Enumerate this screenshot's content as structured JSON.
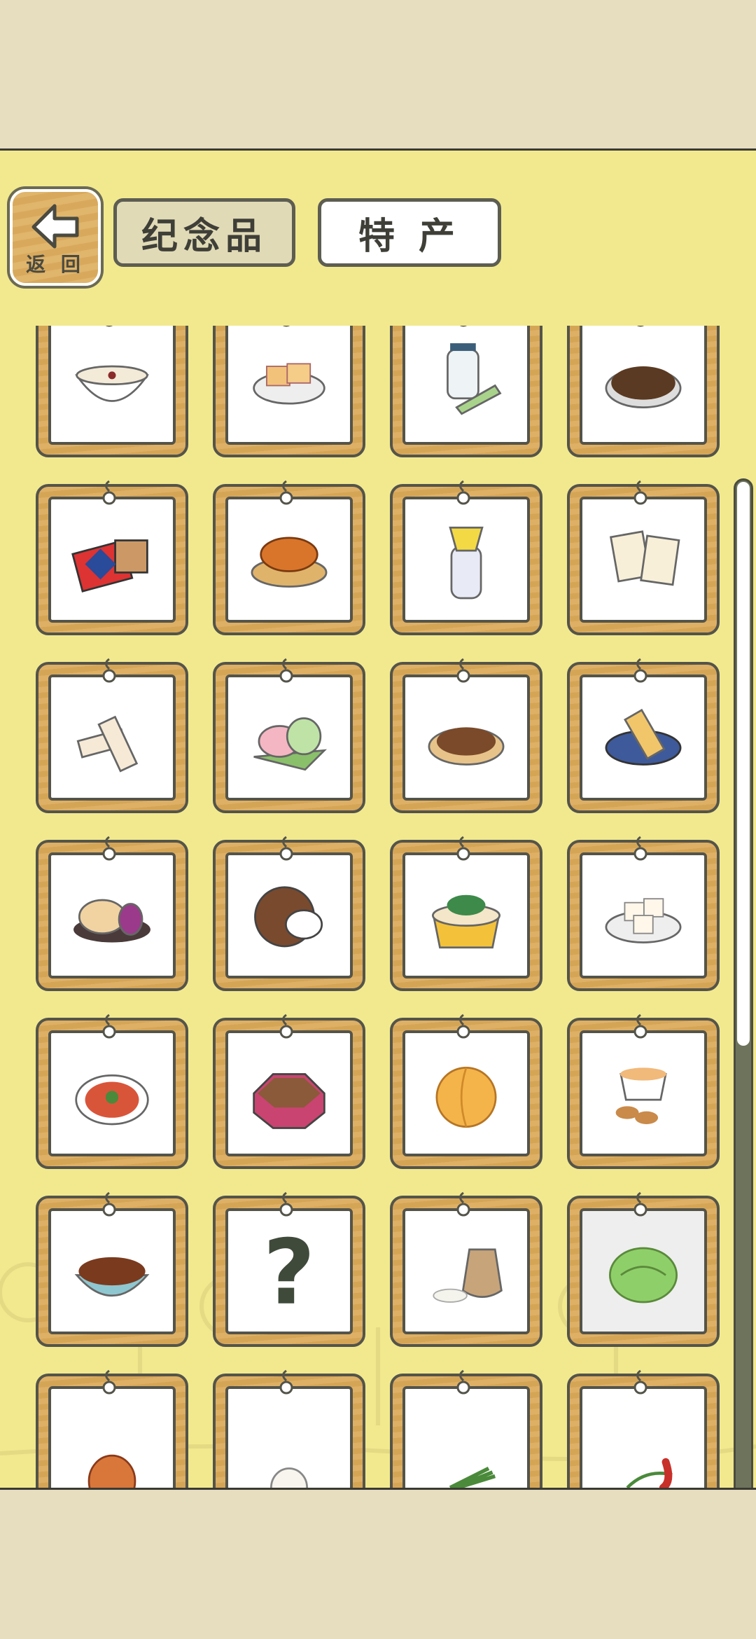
{
  "header": {
    "back_label": "返 回",
    "tabs": [
      {
        "label": "纪念品",
        "active": false
      },
      {
        "label": "特 产",
        "active": true
      }
    ]
  },
  "colors": {
    "page_bg": "#e7ddbf",
    "panel_bg": "#f2e98e",
    "frame_wood": "#deb065",
    "outline": "#54544a"
  },
  "items": [
    {
      "icon": "rice-pudding-bowl-icon"
    },
    {
      "icon": "tofu-plate-icon"
    },
    {
      "icon": "tea-jar-icon"
    },
    {
      "icon": "coffee-beans-plate-icon"
    },
    {
      "icon": "gift-box-icon"
    },
    {
      "icon": "fried-dough-plate-icon"
    },
    {
      "icon": "liquor-bottle-icon"
    },
    {
      "icon": "nougat-blocks-icon"
    },
    {
      "icon": "nougat-sticks-icon"
    },
    {
      "icon": "rice-cakes-icon"
    },
    {
      "icon": "peanuts-plate-icon"
    },
    {
      "icon": "sticky-rice-plate-icon"
    },
    {
      "icon": "mooncake-plate-icon"
    },
    {
      "icon": "coconut-icon"
    },
    {
      "icon": "noodle-bowl-icon"
    },
    {
      "icon": "tofu-cubes-plate-icon"
    },
    {
      "icon": "salad-plate-icon"
    },
    {
      "icon": "snack-box-icon"
    },
    {
      "icon": "peach-icon"
    },
    {
      "icon": "tea-cup-cookies-icon"
    },
    {
      "icon": "braised-meat-bowl-icon"
    },
    {
      "icon": "unknown-item-icon",
      "label": "?"
    },
    {
      "icon": "rice-sack-icon"
    },
    {
      "icon": "cabbage-icon",
      "selected": true
    },
    {
      "icon": "onion-icon"
    },
    {
      "icon": "garlic-icon"
    },
    {
      "icon": "green-onion-icon"
    },
    {
      "icon": "chili-pepper-icon"
    }
  ]
}
